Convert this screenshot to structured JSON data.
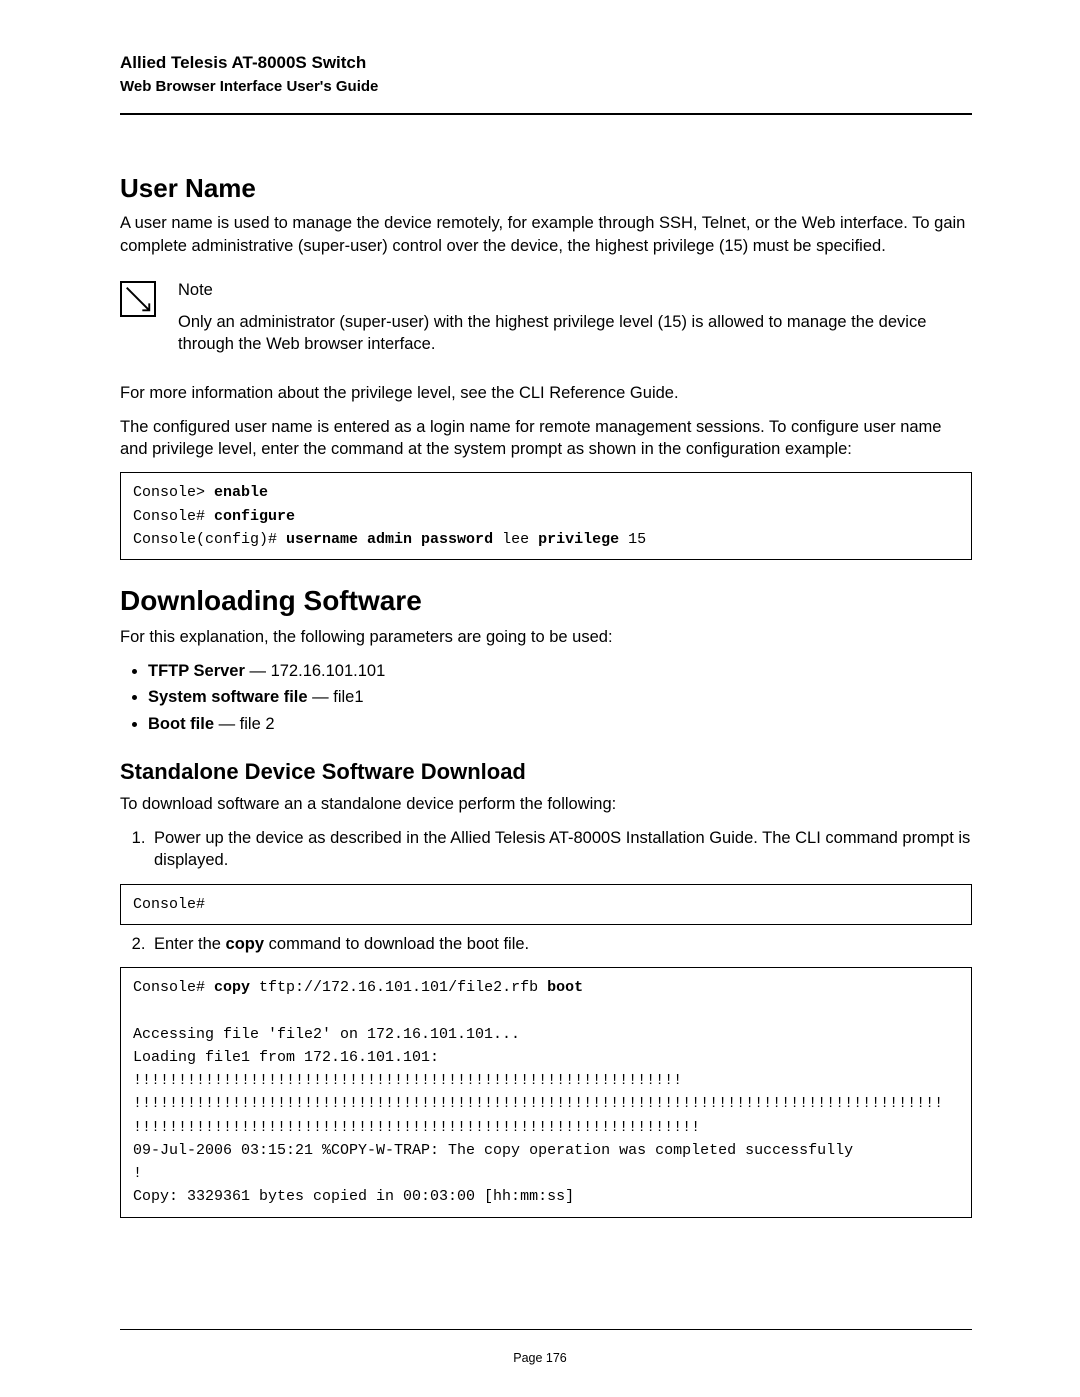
{
  "header": {
    "title": "Allied Telesis AT-8000S Switch",
    "subtitle": "Web Browser Interface User's Guide"
  },
  "section_username": {
    "heading": "User Name",
    "para1": "A user name is used to manage the device remotely, for example through SSH, Telnet, or the Web interface. To gain complete administrative (super-user) control over the device, the highest privilege (15) must be specified.",
    "note_label": "Note",
    "note_body": "Only an administrator (super-user) with the highest privilege level (15) is allowed to manage the device through the Web browser interface.",
    "para2": "For more information about the privilege level, see the CLI Reference Guide.",
    "para3": "The configured user name is entered as a login name for remote management sessions. To configure user name and privilege level, enter the command at the system prompt as shown in the configuration example:"
  },
  "code1": {
    "l1a": "Console> ",
    "l1b": "enable",
    "l2a": "Console# ",
    "l2b": "configure",
    "l3a": "Console(config)# ",
    "l3b": "username admin password",
    "l3c": " lee ",
    "l3d": "privilege",
    "l3e": " 15"
  },
  "section_download": {
    "heading": "Downloading Software",
    "intro": "For this explanation, the following parameters are going to be used:",
    "bullets": {
      "b1_label": "TFTP Server",
      "b1_sep": " — ",
      "b1_val": "172.16.101.101",
      "b2_label": "System software file",
      "b2_sep": " — ",
      "b2_val": "file1",
      "b3_label": "Boot file",
      "b3_sep": " — ",
      "b3_val": "file 2"
    }
  },
  "section_standalone": {
    "heading": "Standalone Device Software Download",
    "intro": "To download software an a standalone device perform the following:",
    "step1": "Power up the device as described in the Allied Telesis AT-8000S Installation Guide. The CLI command prompt is displayed.",
    "step2_a": "Enter the ",
    "step2_b": "copy",
    "step2_c": " command to download the boot file."
  },
  "code2": {
    "line": "Console#"
  },
  "code3": {
    "l1a": "Console# ",
    "l1b": "copy",
    "l1c": " tftp://172.16.101.101/file2.rfb ",
    "l1d": "boot",
    "blank1": "",
    "l2": "Accessing file 'file2' on 172.16.101.101...",
    "l3": "Loading file1 from 172.16.101.101: ",
    "l4": "!!!!!!!!!!!!!!!!!!!!!!!!!!!!!!!!!!!!!!!!!!!!!!!!!!!!!!!!!!!!!",
    "l5": "!!!!!!!!!!!!!!!!!!!!!!!!!!!!!!!!!!!!!!!!!!!!!!!!!!!!!!!!!!!!!!!!!!!!!!!!!!!!!!!!!!!!!!!!!!",
    "l6": "!!!!!!!!!!!!!!!!!!!!!!!!!!!!!!!!!!!!!!!!!!!!!!!!!!!!!!!!!!!!!!!",
    "l7": "09-Jul-2006 03:15:21 %COPY-W-TRAP: The copy operation was completed successfully",
    "l8": "!",
    "l9": "Copy: 3329361 bytes copied in 00:03:00 [hh:mm:ss]"
  },
  "footer": {
    "page": "Page 176"
  }
}
